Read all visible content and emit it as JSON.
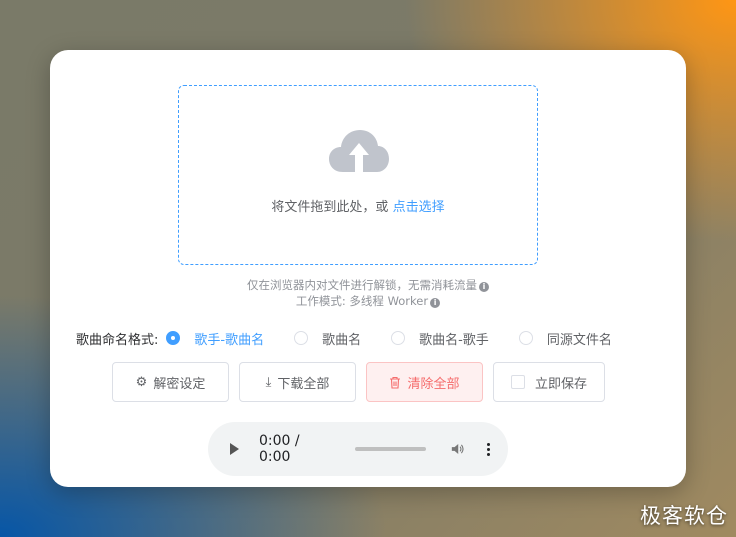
{
  "upload": {
    "prompt": "将文件拖到此处，或",
    "link": "点击选择"
  },
  "tips": {
    "line1": "仅在浏览器内对文件进行解锁，无需消耗流量",
    "line2": "工作模式: 多线程 Worker"
  },
  "naming": {
    "label": "歌曲命名格式:",
    "options": [
      {
        "label": "歌手-歌曲名",
        "checked": true
      },
      {
        "label": "歌曲名",
        "checked": false
      },
      {
        "label": "歌曲名-歌手",
        "checked": false
      },
      {
        "label": "同源文件名",
        "checked": false
      }
    ]
  },
  "buttons": {
    "decrypt_settings": "解密设定",
    "download_all": "下载全部",
    "clear_all": "清除全部",
    "save_now": "立即保存"
  },
  "player": {
    "time": "0:00 / 0:00"
  },
  "watermark": "极客软仓",
  "colors": {
    "primary": "#409eff",
    "danger": "#f56c6c",
    "cloud": "#c0c4cc"
  }
}
